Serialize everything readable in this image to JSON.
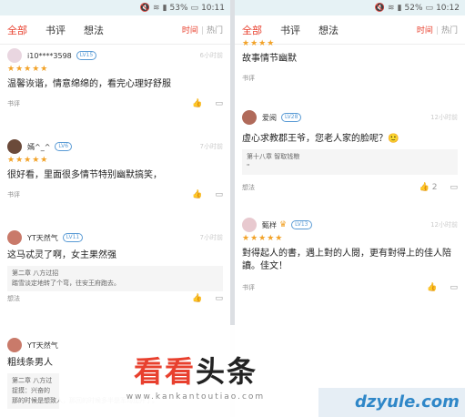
{
  "left": {
    "status": {
      "battery": "53%",
      "time": "10:11"
    },
    "tabs": [
      "全部",
      "书评",
      "想法"
    ],
    "sort": {
      "a": "时间",
      "b": "热门"
    },
    "items": [
      {
        "user": "i10****3598",
        "level": "LV15",
        "time": "6小时前",
        "stars": "★★★★★",
        "text": "温馨诙谐，情意绵绵的，看完心理好舒服",
        "tag": "书评"
      },
      {
        "user": "嫣^_^",
        "level": "LV6",
        "time": "7小时前",
        "stars": "★★★★★",
        "text": "很好看，里面很多情节特别幽默搞笑，",
        "tag": "书评"
      },
      {
        "user": "YT天然气",
        "level": "LV11",
        "time": "7小时前",
        "text": "这马忒灵了啊，女主果然强",
        "quote1": "第二章 八方过招",
        "quote2": "踏雪淡定地转了个弯，往安王府跑去。",
        "tag": "想法"
      },
      {
        "user": "YT天然气",
        "text": "粗线条男人",
        "quote1": "第二章 八方过",
        "quote2": "捉摸：兴奋的",
        "quote3": "那的时候是想致人，那回的时候多半是军均加开了。"
      }
    ]
  },
  "right": {
    "status": {
      "battery": "52%",
      "time": "10:12"
    },
    "tabs": [
      "全部",
      "书评",
      "想法"
    ],
    "sort": {
      "a": "时间",
      "b": "热门"
    },
    "items": [
      {
        "stars": "★★★★",
        "text": "故事情节幽默",
        "tag": "书评"
      },
      {
        "user": "爱阅",
        "level": "LV28",
        "time": "12小时前",
        "text": "虚心求教郡王爷，您老人家的脸呢？",
        "quote1": "第十八章 智取钱粮",
        "tag": "想法",
        "likes": "2"
      },
      {
        "user": "甄样",
        "level": "LV13",
        "time": "12小时前",
        "stars": "★★★★★",
        "text": "對得起人的書，遇上對的人閱，更有對得上的佳人陪讀。佳文！",
        "tag": "书评"
      }
    ]
  },
  "watermark": {
    "t1": "看看",
    "t2": "头条",
    "url": "www.kankantoutiao.com",
    "t3": "dzyule.com"
  },
  "colors": {
    "accent": "#e8402e",
    "star": "#f2a228",
    "level": "#5a9bd5"
  }
}
